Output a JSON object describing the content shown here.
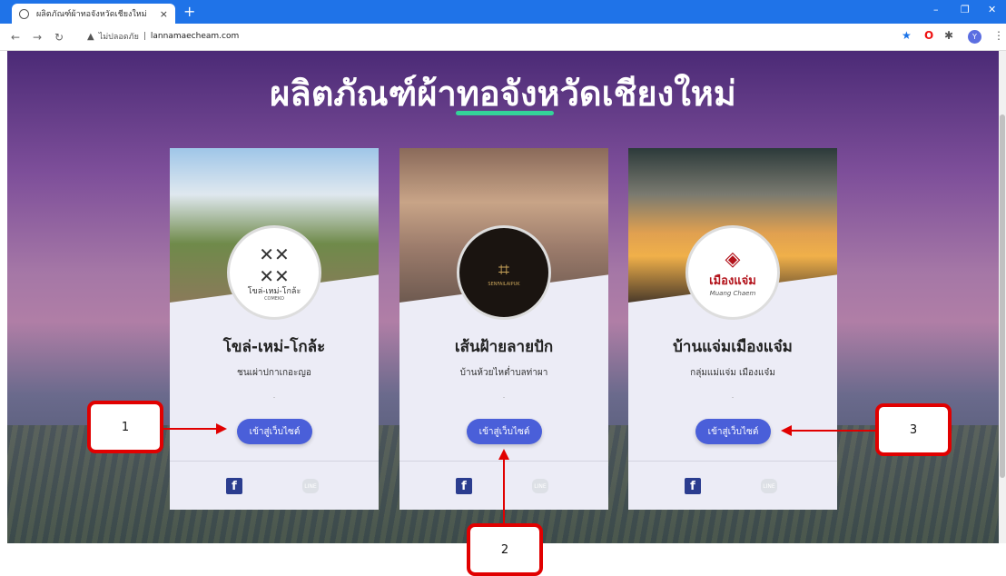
{
  "browser": {
    "tab_title": "ผลิตภัณฑ์ผ้าทอจังหวัดเชียงใหม่",
    "tab_close": "×",
    "new_tab": "+",
    "minimize": "–",
    "maximize": "❐",
    "close": "✕",
    "security_label": "ไม่ปลอดภัย",
    "url_separator": "|",
    "url": "lannamaecheam.com",
    "avatar_letter": "Y"
  },
  "page": {
    "heading": "ผลิตภัณฑ์ผ้าทอจังหวัดเชียงใหม่",
    "accent_color": "#34d399",
    "button_color": "#4a5fd9"
  },
  "cards": [
    {
      "title": "โขล่-เหม่-โกล้ะ",
      "subtitle": "ชนเผ่าปกาเกอะญอ",
      "dot": ".",
      "button": "เข้าสู่เว็บไซต์",
      "logo_text": "โขล่-เหม่-โกล้ะ",
      "logo_sub": "COMEKO",
      "fb": "f",
      "line": "LINE"
    },
    {
      "title": "เส้นฝ้ายลายปัก",
      "subtitle": "บ้านห้วยไหต่ำบลท่าผา",
      "dot": ".",
      "button": "เข้าสู่เว็บไซต์",
      "logo_text": "SENFAILAIPUK",
      "fb": "f",
      "line": "LINE"
    },
    {
      "title": "บ้านแจ่มเมืองแจ๋ม",
      "subtitle": "กลุ่มแม่แจ่ม เมืองแจ๋ม",
      "dot": ".",
      "button": "เข้าสู่เว็บไซต์",
      "logo_text": "เมืองแจ่ม",
      "logo_sub": "Muang Chaem",
      "fb": "f",
      "line": "LINE"
    }
  ],
  "callouts": [
    "1",
    "2",
    "3"
  ]
}
